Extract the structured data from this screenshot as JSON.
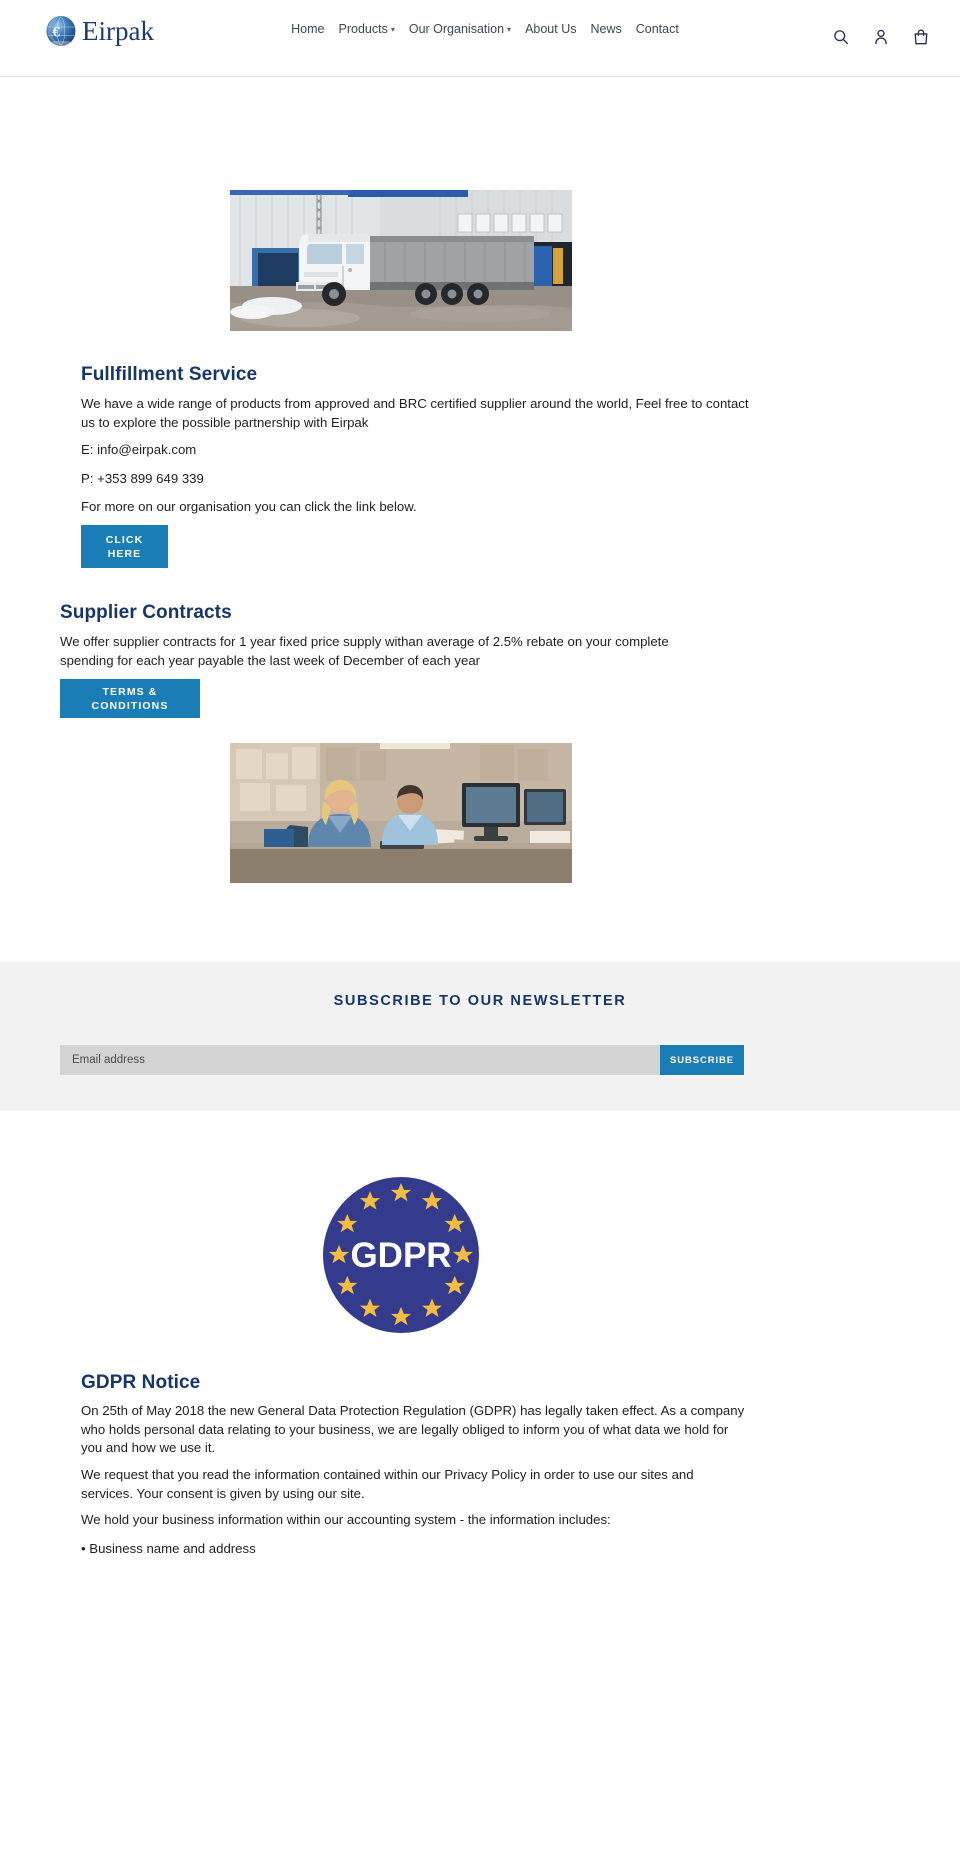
{
  "header": {
    "logo_text": "Eirpak",
    "logo_icon": "euro-globe-logo-icon",
    "nav": [
      {
        "label": "Home",
        "has_caret": false
      },
      {
        "label": "Products",
        "has_caret": true
      },
      {
        "label": "Our Organisation",
        "has_caret": true
      },
      {
        "label": "About Us",
        "has_caret": false
      },
      {
        "label": "News",
        "has_caret": false
      },
      {
        "label": "Contact",
        "has_caret": false
      }
    ],
    "icons": [
      "search-icon",
      "account-icon",
      "cart-icon"
    ]
  },
  "fulfillment": {
    "image_alt": "white-truck-at-warehouse-loading-bay",
    "title": "Fullfillment Service",
    "paragraph": "We have a wide range of products from approved and BRC certified supplier around the world, Feel free to contact us to explore the possible partnership with Eirpak",
    "email_line": "E: info@eirpak.com",
    "phone_line": "P: +353 899 649 339",
    "more_line": "For more on our organisation you can click the link below.",
    "button_line_1": "CLICK",
    "button_line_2": "HERE"
  },
  "supplier": {
    "title": "Supplier Contracts",
    "paragraph": "We offer supplier contracts for 1 year fixed price supply withan average of 2.5% rebate on your complete spending for each year payable the last week of December of each year",
    "button_line_1": "TERMS &",
    "button_line_2": "CONDITIONS",
    "image_alt": "two-office-workers-at-computers-in-warehouse-office"
  },
  "newsletter": {
    "title": "SUBSCRIBE TO OUR NEWSLETTER",
    "email_placeholder": "Email address",
    "email_value": "",
    "subscribe_label": "SUBSCRIBE"
  },
  "gdpr": {
    "badge_text": "GDPR",
    "badge_icon": "gdpr-eu-stars-badge-icon",
    "title": "GDPR Notice",
    "paragraph_1": "On 25th of May 2018 the new General Data Protection Regulation (GDPR) has legally taken effect. As a company who holds personal data relating to your business, we are legally obliged to inform you of what data we hold for you and how we use it.",
    "paragraph_2": "We request that you read the information contained within our Privacy Policy in order to use our sites and services. Your consent is given by using our site.",
    "paragraph_3": "We hold your business information within our accounting system - the information includes:",
    "bullet_1": "• Business name and address"
  },
  "colors": {
    "brand_navy": "#16356b",
    "accent_blue": "#1b7db5",
    "newsletter_bg": "#f2f2f2",
    "input_bg": "#d4d4d4",
    "gdpr_circle": "#343a8c",
    "gdpr_star": "#f5bc42"
  }
}
